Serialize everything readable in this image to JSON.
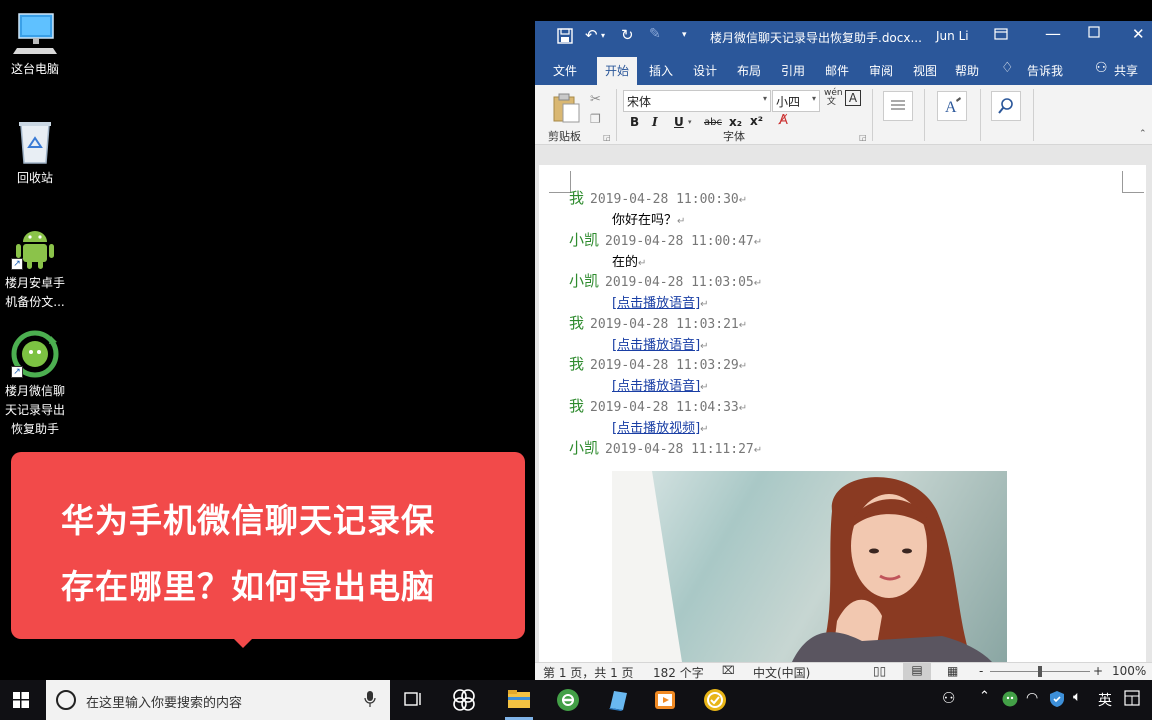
{
  "desktop": {
    "icons": [
      {
        "label": "这台电脑"
      },
      {
        "label": "回收站"
      },
      {
        "label": "楼月安卓手\n机备份文..."
      },
      {
        "label": "楼月微信聊\n天记录导出\n恢复助手"
      }
    ]
  },
  "banner": {
    "line1": "华为手机微信聊天记录保",
    "line2": "存在哪里？如何导出电脑"
  },
  "word": {
    "title": "楼月微信聊天记录导出恢复助手.docx...",
    "user": "Jun Li",
    "tabs": [
      "文件",
      "开始",
      "插入",
      "设计",
      "布局",
      "引用",
      "邮件",
      "审阅",
      "视图",
      "帮助"
    ],
    "active_tab": "开始",
    "tell_me": "告诉我",
    "share": "共享",
    "ribbon": {
      "clipboard_label": "剪贴板",
      "font_name": "宋体",
      "font_size": "小四",
      "font_group_label": "字体",
      "bold": "B",
      "italic": "I",
      "underline": "U",
      "strike": "abc",
      "subscript": "x₂",
      "superscript": "x²"
    },
    "messages": [
      {
        "sender": "我",
        "time": "2019-04-28 11:00:30",
        "content": "你好在吗？",
        "link": false
      },
      {
        "sender": "小凯",
        "time": "2019-04-28 11:00:47",
        "content": "在的",
        "link": false
      },
      {
        "sender": "小凯",
        "time": "2019-04-28 11:03:05",
        "content": "[点击播放语音]",
        "link": true
      },
      {
        "sender": "我",
        "time": "2019-04-28 11:03:21",
        "content": "[点击播放语音]",
        "link": true
      },
      {
        "sender": "我",
        "time": "2019-04-28 11:03:29",
        "content": "[点击播放语音]",
        "link": true
      },
      {
        "sender": "我",
        "time": "2019-04-28 11:04:33",
        "content": "[点击播放视频]",
        "link": true
      },
      {
        "sender": "小凯",
        "time": "2019-04-28 11:11:27",
        "content": "",
        "link": false
      }
    ],
    "pilcrow": "↵",
    "status": {
      "page": "第 1 页，共 1 页",
      "words": "182 个字",
      "language": "中文(中国)",
      "zoom": "100%",
      "minus": "-",
      "plus": "+"
    }
  },
  "taskbar": {
    "search_placeholder": "在这里输入你要搜索的内容",
    "ime": "英"
  },
  "colors": {
    "word_blue": "#2b579a",
    "banner_red": "#f24a4a",
    "sender_green": "#2e8b2e"
  }
}
